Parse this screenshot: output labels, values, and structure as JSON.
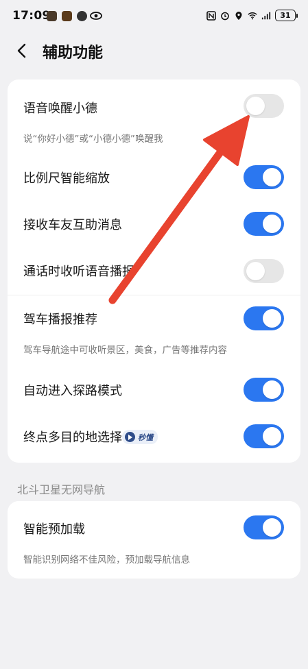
{
  "status_bar": {
    "time": "17:09",
    "battery": "31"
  },
  "header": {
    "title": "辅助功能"
  },
  "settings": [
    {
      "label": "语音唤醒小德",
      "desc": "说“你好小德”或“小德小德”唤醒我",
      "enabled": false
    },
    {
      "label": "比例尺智能缩放",
      "enabled": true
    },
    {
      "label": "接收车友互助消息",
      "enabled": true
    },
    {
      "label": "通话时收听语音播报",
      "enabled": false
    },
    {
      "label": "驾车播报推荐",
      "desc": "驾车导航途中可收听景区，美食，广告等推荐内容",
      "enabled": true
    },
    {
      "label": "自动进入探路模式",
      "enabled": true
    },
    {
      "label": "终点多目的地选择",
      "badge": "秒懂",
      "enabled": true
    }
  ],
  "section": {
    "title": "北斗卫星无网导航"
  },
  "section_settings": [
    {
      "label": "智能预加载",
      "desc": "智能识别网络不佳风险，预加载导航信息",
      "enabled": true
    }
  ],
  "colors": {
    "toggle_on": "#2b77f0",
    "toggle_off": "#e6e6e6",
    "annotation_arrow": "#e8432f"
  }
}
